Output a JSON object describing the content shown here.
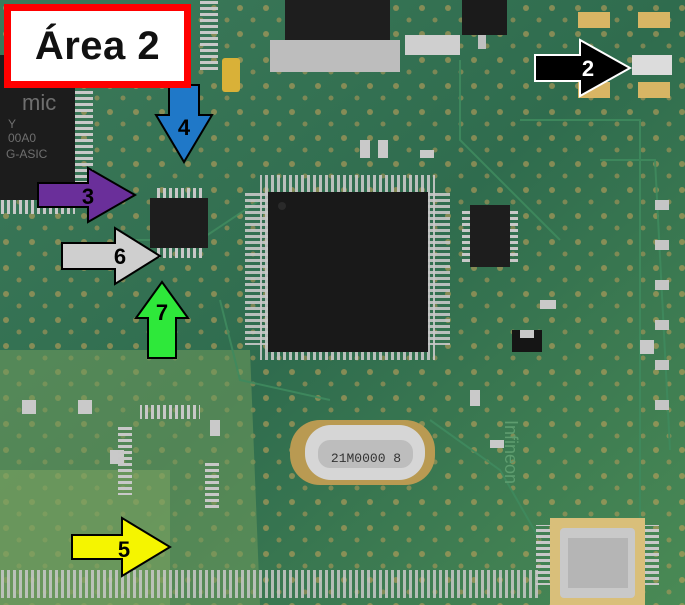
{
  "title": "Área 2",
  "chip_markings": {
    "asic_left": [
      "mic",
      "Y",
      "00A0",
      "G-ASIC"
    ],
    "crystal": "21M0000 8",
    "board_edge": "Infineon"
  },
  "arrows": [
    {
      "label": "2",
      "color": "#000000",
      "text_color": "#ffffff"
    },
    {
      "label": "3",
      "color": "#6a2f9a",
      "text_color": "#000000"
    },
    {
      "label": "4",
      "color": "#1f78c8",
      "text_color": "#000000"
    },
    {
      "label": "5",
      "color": "#f5f500",
      "text_color": "#000000"
    },
    {
      "label": "6",
      "color": "#cfcfcf",
      "text_color": "#000000"
    },
    {
      "label": "7",
      "color": "#2ee83a",
      "text_color": "#000000"
    }
  ]
}
